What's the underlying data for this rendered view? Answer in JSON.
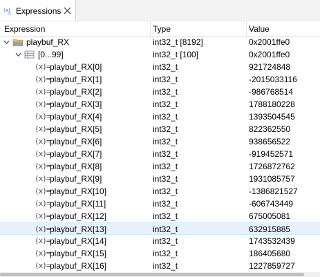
{
  "tab": {
    "title": "Expressions",
    "icon": "expressions-icon",
    "close_icon": "close-icon"
  },
  "columns": {
    "expression": "Expression",
    "type": "Type",
    "value": "Value"
  },
  "root": {
    "name": "playbuf_RX",
    "type": "int32_t [8192]",
    "value": "0x2001ffe0"
  },
  "range": {
    "name": "[0...99]",
    "type": "int32_t [100]",
    "value": "0x2001ffe0"
  },
  "elements": [
    {
      "name": "playbuf_RX[0]",
      "type": "int32_t",
      "value": "921724848"
    },
    {
      "name": "playbuf_RX[1]",
      "type": "int32_t",
      "value": "-2015033116"
    },
    {
      "name": "playbuf_RX[2]",
      "type": "int32_t",
      "value": "-986768514"
    },
    {
      "name": "playbuf_RX[3]",
      "type": "int32_t",
      "value": "1788180228"
    },
    {
      "name": "playbuf_RX[4]",
      "type": "int32_t",
      "value": "1393504545"
    },
    {
      "name": "playbuf_RX[5]",
      "type": "int32_t",
      "value": "822362550"
    },
    {
      "name": "playbuf_RX[6]",
      "type": "int32_t",
      "value": "938656522"
    },
    {
      "name": "playbuf_RX[7]",
      "type": "int32_t",
      "value": "-919452571"
    },
    {
      "name": "playbuf_RX[8]",
      "type": "int32_t",
      "value": "1726872762"
    },
    {
      "name": "playbuf_RX[9]",
      "type": "int32_t",
      "value": "1931085757"
    },
    {
      "name": "playbuf_RX[10]",
      "type": "int32_t",
      "value": "-1386821527"
    },
    {
      "name": "playbuf_RX[11]",
      "type": "int32_t",
      "value": "-606743449"
    },
    {
      "name": "playbuf_RX[12]",
      "type": "int32_t",
      "value": "675005081"
    },
    {
      "name": "playbuf_RX[13]",
      "type": "int32_t",
      "value": "632915885"
    },
    {
      "name": "playbuf_RX[14]",
      "type": "int32_t",
      "value": "1743532439"
    },
    {
      "name": "playbuf_RX[15]",
      "type": "int32_t",
      "value": "186405680"
    },
    {
      "name": "playbuf_RX[16]",
      "type": "int32_t",
      "value": "1227859727"
    }
  ],
  "selected_index": 13,
  "variable_icon_glyph": "(x)=",
  "colors": {
    "selection": "#e5f1fb",
    "selection_border": "#cde8ff",
    "folder": "#e6a23c",
    "chevron": "#444444"
  }
}
